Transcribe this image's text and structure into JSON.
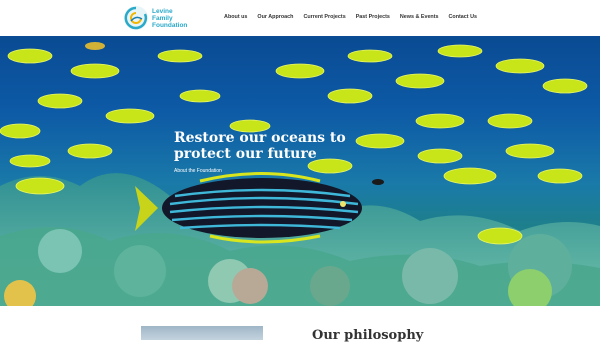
{
  "logo": {
    "line1": "Levine",
    "line2": "Family",
    "line3": "Foundation",
    "accent_color": "#2aa9c9"
  },
  "nav": {
    "items": [
      {
        "label": "About us"
      },
      {
        "label": "Our Approach"
      },
      {
        "label": "Current Projects"
      },
      {
        "label": "Past Projects"
      },
      {
        "label": "News & Events"
      },
      {
        "label": "Contact Us"
      }
    ]
  },
  "hero": {
    "title": "Restore our oceans to protect our future",
    "link": "About the Foundation",
    "colors": {
      "water": "#0d5aa6",
      "fish_yellow": "#c8e51a",
      "reef": "#3aa38f"
    }
  },
  "below": {
    "heading": "Our philosophy"
  }
}
